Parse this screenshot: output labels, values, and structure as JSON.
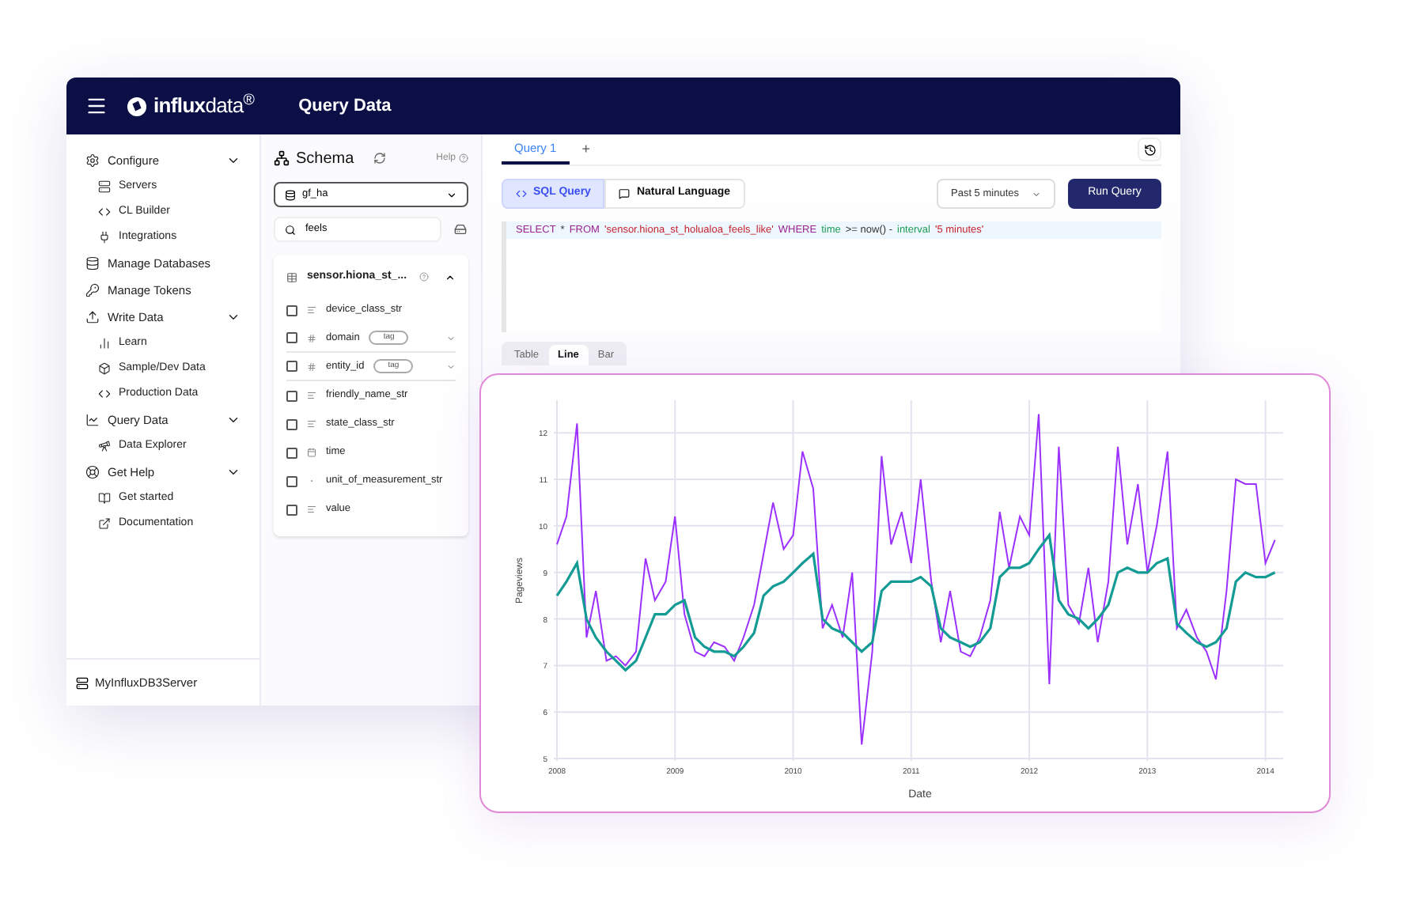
{
  "header": {
    "logo": "**influx**data$^{®}$",
    "title": "Query Data"
  },
  "nav": [
    {
      "kind": "group",
      "label": "Configure",
      "expanded": true,
      "children": [
        {
          "label": "Servers"
        },
        {
          "label": "CL Builder"
        },
        {
          "label": "Integrations"
        }
      ]
    },
    {
      "kind": "link",
      "label": "Manage Databases"
    },
    {
      "kind": "link",
      "label": "Manage Tokens"
    },
    {
      "kind": "group",
      "label": "Write Data",
      "expanded": true,
      "children": [
        {
          "label": "Learn"
        },
        {
          "label": "Sample/Dev Data"
        },
        {
          "label": "Production Data"
        }
      ]
    },
    {
      "kind": "group",
      "label": "Query Data",
      "expanded": true,
      "children": [
        {
          "label": "Data Explorer"
        }
      ]
    },
    {
      "kind": "group",
      "label": "Get Help",
      "expanded": true,
      "children": [
        {
          "label": "Get started"
        },
        {
          "label": "Documentation"
        }
      ]
    }
  ],
  "server": "MyInfluxDB3Server",
  "schema": {
    "title": "Schema",
    "help": "Help",
    "database": "gf_ha",
    "search": "feels",
    "measurement": {
      "name": "sensor.hiona_st_...",
      "expanded": true,
      "fields": [
        {
          "kind": "text",
          "name": "device_class_str",
          "checked": false
        },
        {
          "kind": "tag",
          "name": "domain",
          "badge": "tag",
          "checked": false
        },
        {
          "kind": "tag",
          "name": "entity_id",
          "badge": "tag",
          "checked": false
        },
        {
          "kind": "text",
          "name": "friendly_name_str",
          "checked": false
        },
        {
          "kind": "text",
          "name": "state_class_str",
          "checked": false
        },
        {
          "kind": "time",
          "name": "time",
          "checked": false
        },
        {
          "kind": "other",
          "name": "unit_of_measurement_str",
          "checked": false
        },
        {
          "kind": "text",
          "name": "value",
          "checked": false
        }
      ]
    }
  },
  "query_tabs": [
    {
      "label": "Query 1",
      "selected": true
    }
  ],
  "add_tab": "+",
  "modes": [
    {
      "label": "SQL Query",
      "selected": true
    },
    {
      "label": "Natural Language",
      "selected": false
    }
  ],
  "time_range": "Past 5 minutes",
  "run_button": "Run Query",
  "sql": [
    {
      "kind": "keyword",
      "text": "SELECT"
    },
    {
      "kind": "plain",
      "text": "*"
    },
    {
      "kind": "keyword",
      "text": "FROM"
    },
    {
      "kind": "string",
      "text": "'sensor.hiona_st_holualoa_feels_like'"
    },
    {
      "kind": "keyword",
      "text": "WHERE"
    },
    {
      "kind": "function",
      "text": "time"
    },
    {
      "kind": "plain",
      "text": ">= now() -"
    },
    {
      "kind": "function",
      "text": "interval"
    },
    {
      "kind": "string",
      "text": "'5 minutes'"
    }
  ],
  "view_tabs": [
    {
      "label": "Table",
      "selected": false
    },
    {
      "label": "Line",
      "selected": true
    },
    {
      "label": "Bar",
      "selected": false
    }
  ],
  "chart": {
    "chart_data": {
      "type": "line",
      "grid": true,
      "xlabel": "Date",
      "ylabel": "Pageviews",
      "xlim": [
        2008,
        2014.15
      ],
      "ylim": [
        4.95,
        12.7
      ],
      "xticks": [
        2008,
        2009,
        2010,
        2011,
        2012,
        2013,
        2014
      ],
      "yticks": [
        5,
        6,
        7,
        8,
        9,
        10,
        11,
        12
      ],
      "x": [
        2008.0,
        2008.08,
        2008.17,
        2008.25,
        2008.33,
        2008.42,
        2008.5,
        2008.58,
        2008.67,
        2008.75,
        2008.83,
        2008.92,
        2009.0,
        2009.08,
        2009.17,
        2009.25,
        2009.33,
        2009.42,
        2009.5,
        2009.58,
        2009.67,
        2009.75,
        2009.83,
        2009.92,
        2010.0,
        2010.08,
        2010.17,
        2010.25,
        2010.33,
        2010.42,
        2010.5,
        2010.58,
        2010.67,
        2010.75,
        2010.83,
        2010.92,
        2011.0,
        2011.08,
        2011.17,
        2011.25,
        2011.33,
        2011.42,
        2011.5,
        2011.58,
        2011.67,
        2011.75,
        2011.83,
        2011.92,
        2012.0,
        2012.08,
        2012.17,
        2012.25,
        2012.33,
        2012.42,
        2012.5,
        2012.58,
        2012.67,
        2012.75,
        2012.83,
        2012.92,
        2013.0,
        2013.08,
        2013.17,
        2013.25,
        2013.33,
        2013.42,
        2013.5,
        2013.58,
        2013.67,
        2013.75,
        2013.83,
        2013.92,
        2014.0,
        2014.08
      ],
      "series": [
        {
          "color": "#9b30ff",
          "values": [
            9.6,
            10.2,
            12.2,
            7.6,
            8.6,
            7.1,
            7.2,
            7.0,
            7.3,
            9.3,
            8.4,
            8.8,
            10.2,
            8.1,
            7.3,
            7.2,
            7.5,
            7.4,
            7.1,
            7.6,
            8.3,
            9.4,
            10.5,
            9.5,
            9.8,
            11.6,
            10.8,
            7.8,
            8.3,
            7.6,
            9.0,
            5.3,
            7.3,
            11.5,
            9.6,
            10.3,
            9.2,
            11.0,
            8.8,
            7.5,
            8.6,
            7.3,
            7.2,
            7.6,
            8.4,
            10.3,
            9.1,
            10.2,
            9.8,
            12.4,
            6.6,
            11.7,
            8.3,
            7.9,
            9.1,
            7.5,
            8.8,
            11.7,
            9.6,
            10.9,
            9.0,
            10.0,
            11.6,
            7.8,
            8.2,
            7.6,
            7.3,
            6.7,
            8.6,
            11.0,
            10.9,
            10.9,
            9.2,
            9.7
          ]
        },
        {
          "color": "#139b94",
          "values": [
            8.5,
            8.8,
            9.2,
            8.0,
            7.6,
            7.3,
            7.1,
            6.9,
            7.1,
            7.6,
            8.1,
            8.1,
            8.3,
            8.4,
            7.6,
            7.4,
            7.3,
            7.3,
            7.2,
            7.4,
            7.7,
            8.5,
            8.7,
            8.8,
            9.0,
            9.2,
            9.4,
            8.0,
            7.8,
            7.7,
            7.5,
            7.3,
            7.5,
            8.6,
            8.8,
            8.8,
            8.8,
            8.9,
            8.7,
            7.8,
            7.6,
            7.5,
            7.4,
            7.5,
            7.8,
            8.9,
            9.1,
            9.1,
            9.2,
            9.5,
            9.8,
            8.4,
            8.1,
            8.0,
            7.8,
            8.0,
            8.3,
            9.0,
            9.1,
            9.0,
            9.0,
            9.2,
            9.3,
            7.9,
            7.7,
            7.5,
            7.4,
            7.5,
            7.8,
            8.8,
            9.0,
            8.9,
            8.9,
            9.0
          ]
        }
      ]
    }
  }
}
